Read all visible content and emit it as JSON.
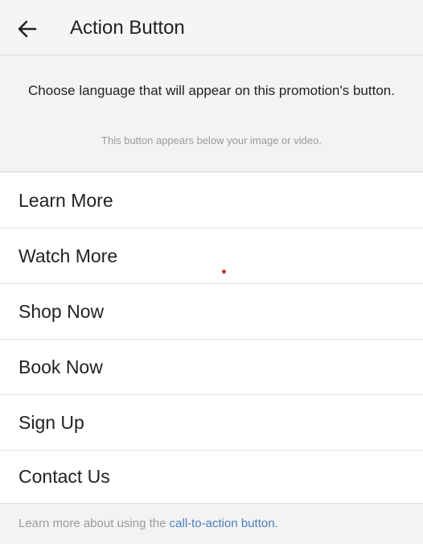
{
  "header": {
    "title": "Action Button",
    "back_icon": "arrow-left-icon"
  },
  "intro": {
    "main_text": "Choose language that will appear on this promotion's button.",
    "sub_text": "This button appears below your image or video."
  },
  "options": [
    {
      "label": "Learn More"
    },
    {
      "label": "Watch More"
    },
    {
      "label": "Shop Now"
    },
    {
      "label": "Book Now"
    },
    {
      "label": "Sign Up"
    },
    {
      "label": "Contact Us"
    }
  ],
  "footer": {
    "text": "Learn more about using the",
    "link_text": "call-to-action button."
  },
  "colors": {
    "link": "#4a7fc0",
    "marker": "#d32f2f",
    "background": "#f3f3f3"
  }
}
